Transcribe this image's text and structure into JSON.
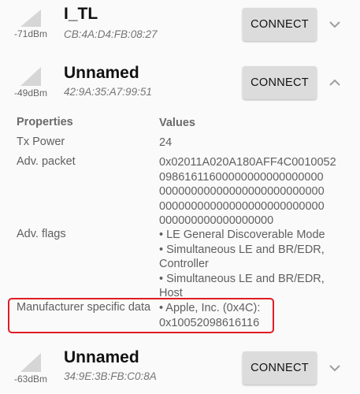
{
  "devices": [
    {
      "name": "I_TL",
      "mac": "CB:4A:D4:FB:08:27",
      "rssi": "-71dBm",
      "button": "CONNECT",
      "expanded": false,
      "chevron_icon": "chevron-down-icon"
    },
    {
      "name": "Unnamed",
      "mac": "42:9A:35:A7:99:51",
      "rssi": "-49dBm",
      "button": "CONNECT",
      "expanded": true,
      "chevron_icon": "chevron-up-icon",
      "properties_header": "Properties",
      "values_header": "Values",
      "properties": [
        {
          "key": "Tx Power",
          "lines": [
            "24"
          ]
        },
        {
          "key": "Adv. packet",
          "lines": [
            "0x02011A020A180AFF4C0010052",
            "09861611600000000000000000",
            "00000000000000000000000000",
            "00000000000000000000000000",
            "000000000000000000"
          ]
        },
        {
          "key": "Adv. flags",
          "lines": [
            "• LE General Discoverable Mode",
            "• Simultaneous LE and BR/EDR,",
            "Controller",
            "• Simultaneous LE and BR/EDR,",
            "Host"
          ]
        },
        {
          "key": "Manufacturer specific data",
          "lines": [
            "• Apple, Inc. (0x4C):",
            "0x10052098616116"
          ],
          "highlighted": true
        }
      ]
    },
    {
      "name": "Unnamed",
      "mac": "34:9E:3B:FB:C0:8A",
      "rssi": "-63dBm",
      "button": "CONNECT",
      "expanded": false,
      "chevron_icon": "chevron-down-icon"
    }
  ],
  "colors": {
    "highlight_border": "#e01b24",
    "button_bg": "#dcdcdc",
    "signal_icon": "#d6d6d6"
  }
}
